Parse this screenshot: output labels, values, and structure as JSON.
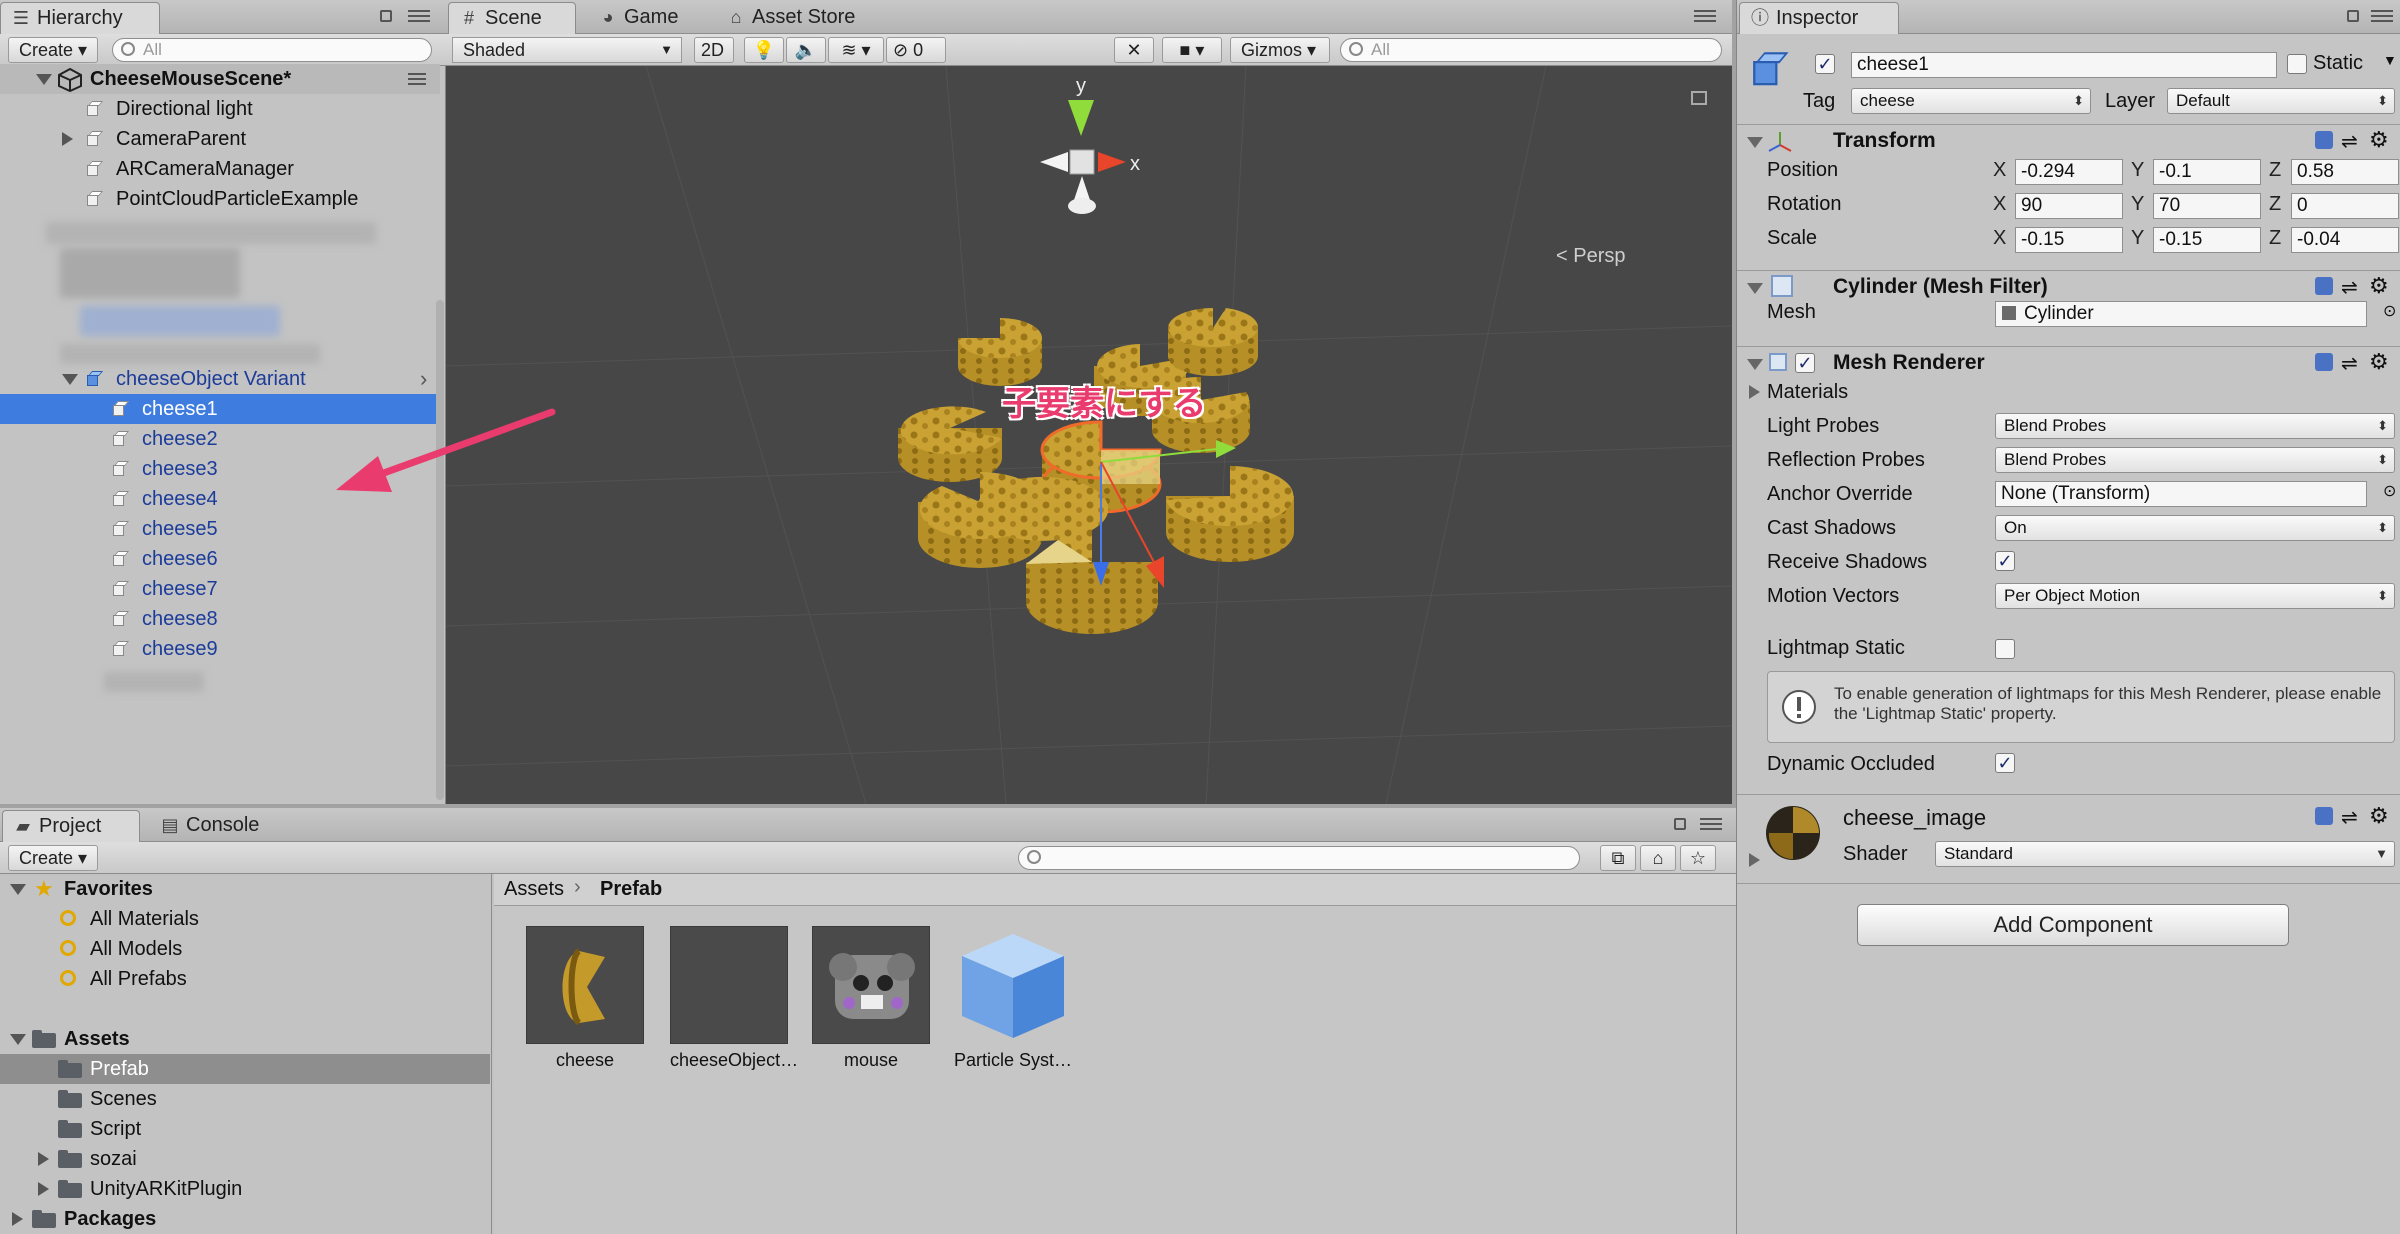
{
  "hierarchy": {
    "tab_label": "Hierarchy",
    "create_label": "Create",
    "search_placeholder": "All",
    "scene_name": "CheeseMouseScene*",
    "items": [
      {
        "label": "Directional light"
      },
      {
        "label": "CameraParent"
      },
      {
        "label": "ARCameraManager"
      },
      {
        "label": "PointCloudParticleExample"
      }
    ],
    "variant": {
      "label": "cheeseObject Variant"
    },
    "children": [
      {
        "label": "cheese1"
      },
      {
        "label": "cheese2"
      },
      {
        "label": "cheese3"
      },
      {
        "label": "cheese4"
      },
      {
        "label": "cheese5"
      },
      {
        "label": "cheese6"
      },
      {
        "label": "cheese7"
      },
      {
        "label": "cheese8"
      },
      {
        "label": "cheese9"
      }
    ]
  },
  "scene": {
    "tabs": [
      {
        "label": "Scene",
        "icon": "hash-icon"
      },
      {
        "label": "Game",
        "icon": "pacman-icon"
      },
      {
        "label": "Asset Store",
        "icon": "store-icon"
      }
    ],
    "shading_mode": "Shaded",
    "mode_2d": "2D",
    "hidden_count": "0",
    "gizmos_label": "Gizmos",
    "search_placeholder": "All",
    "persp_label": "Persp",
    "axis_y": "y",
    "axis_x": "x",
    "annotation": "子要素にする",
    "annotation_color": "#ea3b6e"
  },
  "inspector": {
    "tab_label": "Inspector",
    "object_name": "cheese1",
    "static_label": "Static",
    "tag_label": "Tag",
    "tag_value": "cheese",
    "layer_label": "Layer",
    "layer_value": "Default",
    "transform": {
      "title": "Transform",
      "position_label": "Position",
      "rotation_label": "Rotation",
      "scale_label": "Scale",
      "position": {
        "x": "-0.294",
        "y": "-0.1",
        "z": "0.58"
      },
      "rotation": {
        "x": "90",
        "y": "70",
        "z": "0"
      },
      "scale": {
        "x": "-0.15",
        "y": "-0.15",
        "z": "-0.04"
      }
    },
    "axis_x": "X",
    "axis_y": "Y",
    "axis_z": "Z",
    "mesh_filter": {
      "title": "Cylinder (Mesh Filter)",
      "mesh_label": "Mesh",
      "mesh_value": "Cylinder"
    },
    "mesh_renderer": {
      "title": "Mesh Renderer",
      "materials_label": "Materials",
      "light_probes_label": "Light Probes",
      "light_probes_value": "Blend Probes",
      "reflection_probes_label": "Reflection Probes",
      "reflection_probes_value": "Blend Probes",
      "anchor_override_label": "Anchor Override",
      "anchor_override_value": "None (Transform)",
      "cast_shadows_label": "Cast Shadows",
      "cast_shadows_value": "On",
      "receive_shadows_label": "Receive Shadows",
      "motion_vectors_label": "Motion Vectors",
      "motion_vectors_value": "Per Object Motion",
      "lightmap_static_label": "Lightmap Static",
      "info_text": "To enable generation of lightmaps for this Mesh Renderer, please enable the 'Lightmap Static' property.",
      "dynamic_occluded_label": "Dynamic Occluded"
    },
    "material": {
      "name": "cheese_image",
      "shader_label": "Shader",
      "shader_value": "Standard"
    },
    "add_component_label": "Add Component"
  },
  "project": {
    "tabs": [
      {
        "label": "Project"
      },
      {
        "label": "Console"
      }
    ],
    "create_label": "Create",
    "favorites_label": "Favorites",
    "favorites": [
      {
        "label": "All Materials"
      },
      {
        "label": "All Models"
      },
      {
        "label": "All Prefabs"
      }
    ],
    "assets_label": "Assets",
    "folders": [
      {
        "label": "Prefab"
      },
      {
        "label": "Scenes"
      },
      {
        "label": "Script"
      },
      {
        "label": "sozai"
      },
      {
        "label": "UnityARKitPlugin"
      }
    ],
    "packages_label": "Packages",
    "breadcrumb": {
      "root": "Assets",
      "current": "Prefab"
    },
    "grid": [
      {
        "label": "cheese"
      },
      {
        "label": "cheeseObject…"
      },
      {
        "label": "mouse"
      },
      {
        "label": "Particle Syst…"
      }
    ]
  },
  "colors": {
    "selection": "#3e7ce0",
    "prefab_text": "#1c3c9a",
    "scene_bg": "#474747",
    "cheese": "#c9a233"
  }
}
